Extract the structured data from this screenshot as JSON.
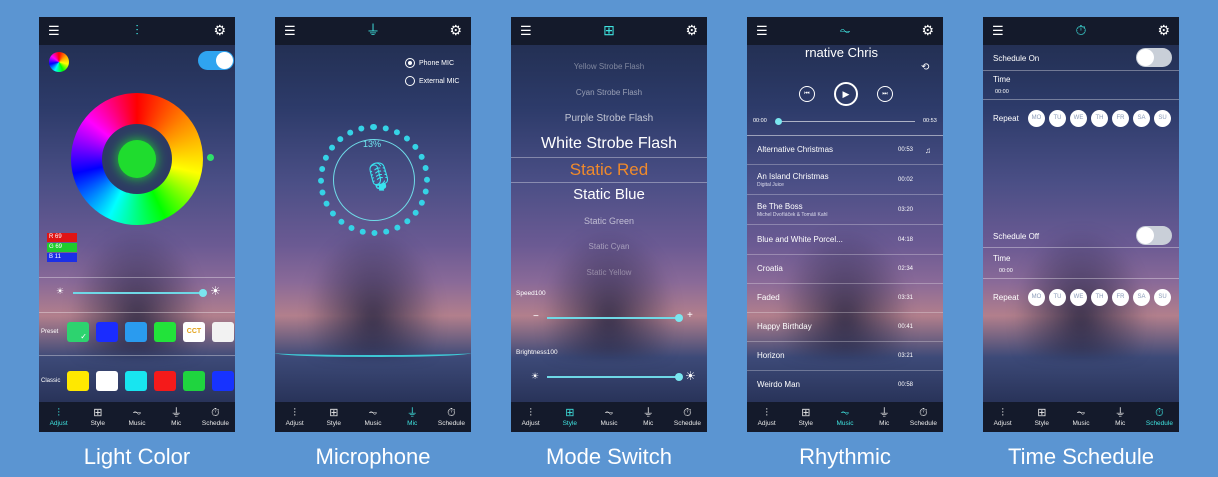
{
  "tab_labels": [
    "Adjust",
    "Style",
    "Music",
    "Mic",
    "Schedule"
  ],
  "icons": {
    "menu": "list-icon",
    "settings": "gear-icon",
    "adjust": "sliders-icon",
    "style": "grid-icon",
    "music": "music-wave-icon",
    "mic": "microphone-icon",
    "schedule": "stopwatch-icon"
  },
  "captions": [
    "Light Color",
    "Microphone",
    "Mode Switch",
    "Rhythmic",
    "Time Schedule"
  ],
  "light_color": {
    "power_on": true,
    "rgb": {
      "r_label": "R",
      "r_value": "69",
      "g_label": "G",
      "g_value": "69",
      "b_label": "B",
      "b_value": "11"
    },
    "brightness_fraction": 0.9,
    "preset_label": "Preset",
    "preset_cct": "CCT",
    "classic_label": "Classic",
    "preset_colors": [
      "#2dd36f",
      "#1a2cff",
      "#2a9bef",
      "#22e33a",
      "#ffffff",
      "#ffffff"
    ],
    "classic_colors": [
      "#ffe800",
      "#ffffff",
      "#18e5f0",
      "#f51a1a",
      "#1fd43f",
      "#1733ff"
    ]
  },
  "microphone": {
    "phone_mic": "Phone MIC",
    "external_mic": "External MIC",
    "selected": "Phone MIC",
    "level": "13%"
  },
  "mode_switch": {
    "modes": [
      "Yellow Strobe Flash",
      "Cyan Strobe Flash",
      "Purple Strobe Flash",
      "White Strobe Flash",
      "Static Red",
      "Static Blue",
      "Static Green",
      "Static Cyan",
      "Static Yellow"
    ],
    "selected": "Static Red",
    "speed_label": "Speed100",
    "speed_fraction": 1.0,
    "brightness_label": "Brightness100",
    "brightness_fraction": 1.0,
    "minus": "−",
    "plus": "+"
  },
  "rhythmic": {
    "now_playing": "rnative Chris",
    "time_start": "00:00",
    "time_end": "00:53",
    "songs": [
      {
        "title": "Alternative Christmas",
        "sub": "",
        "dur": "00:53"
      },
      {
        "title": "An Island Christmas",
        "sub": "Digital Juice",
        "dur": "00:02"
      },
      {
        "title": "Be The Boss",
        "sub": "Michel Dvoříáček & Tomáš Kahl",
        "dur": "03:20"
      },
      {
        "title": "Blue and White Porcel...",
        "sub": "",
        "dur": "04:18"
      },
      {
        "title": "Croatia",
        "sub": "",
        "dur": "02:34"
      },
      {
        "title": "Faded",
        "sub": "",
        "dur": "03:31"
      },
      {
        "title": "Happy Birthday",
        "sub": "",
        "dur": "00:41"
      },
      {
        "title": "Horizon",
        "sub": "",
        "dur": "03:21"
      },
      {
        "title": "Weirdo Man",
        "sub": "",
        "dur": "00:58"
      }
    ]
  },
  "time_schedule": {
    "on_label": "Schedule On",
    "off_label": "Schedule Off",
    "time_label": "Time",
    "time_value": "00:00",
    "repeat_label": "Repeat",
    "days": [
      "MO",
      "TU",
      "WE",
      "TH",
      "FR",
      "SA",
      "SU"
    ]
  }
}
